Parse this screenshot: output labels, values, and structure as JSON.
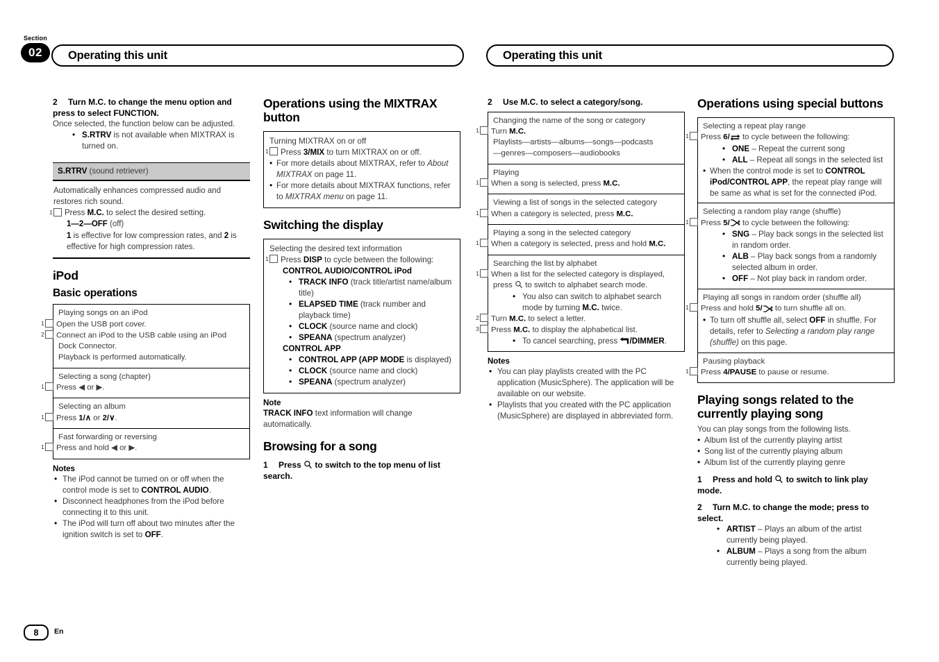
{
  "header": {
    "section_label": "Section",
    "section_number": "02",
    "title_left": "Operating this unit",
    "title_right": "Operating this unit"
  },
  "footer": {
    "page_number": "8",
    "language": "En"
  },
  "col1": {
    "step2_num": "2",
    "step2_text": "Turn M.C. to change the menu option and press to select FUNCTION.",
    "step2_body": "Once selected, the function below can be adjusted.",
    "step2_bullet_1_bold": "S.RTRV",
    "step2_bullet_1_rest": " is not available when MIXTRAX is turned on.",
    "srtrv_band_bold": "S.RTRV",
    "srtrv_band_rest": " (sound retriever)",
    "srtrv_line1": "Automatically enhances compressed audio and restores rich sound.",
    "srtrv_step_marker": "1",
    "srtrv_step_1a": "Press ",
    "srtrv_step_1b": "M.C.",
    "srtrv_step_1c": " to select the desired setting.",
    "srtrv_values": "1—2—OFF (off)",
    "srtrv_values_bold1": "1",
    "srtrv_values_dash1": "—",
    "srtrv_values_bold2": "2",
    "srtrv_values_dash2": "—",
    "srtrv_values_bold3": "OFF",
    "srtrv_values_tail": " (off)",
    "srtrv_note_a": "1",
    "srtrv_note_b": " is effective for low compression rates, and ",
    "srtrv_note_c": "2",
    "srtrv_note_d": " is effective for high compression rates.",
    "ipod_title": "iPod",
    "basic_ops_title": "Basic operations",
    "box_rows": [
      {
        "caption": "Playing songs on an iPod",
        "lines": [
          {
            "marker": "1",
            "text": "Open the USB port cover."
          },
          {
            "marker": "2",
            "text": "Connect an iPod to the USB cable using an iPod Dock Connector."
          },
          {
            "marker": "",
            "text": "Playback is performed automatically."
          }
        ]
      },
      {
        "caption": "Selecting a song (chapter)",
        "lines": [
          {
            "marker": "1",
            "text": "Press ◀ or ▶."
          }
        ]
      },
      {
        "caption": "Selecting an album",
        "lines": [
          {
            "marker": "1",
            "text": "Press 1/∧ or 2/∨."
          }
        ]
      },
      {
        "caption": "Fast forwarding or reversing",
        "lines": [
          {
            "marker": "1",
            "text": "Press and hold ◀ or ▶."
          }
        ]
      }
    ],
    "notes_title": "Notes",
    "notes": [
      "The iPod cannot be turned on or off when the control mode is set to CONTROL AUDIO.",
      "Disconnect headphones from the iPod before connecting it to this unit.",
      "The iPod will turn off about two minutes after the ignition switch is set to OFF."
    ]
  },
  "col2": {
    "mixtrax_title": "Operations using the MIXTRAX button",
    "mixtrax_box_caption": "Turning MIXTRAX on or off",
    "mixtrax_step_marker": "1",
    "mixtrax_step_text": "Press 3/MIX to turn MIXTRAX on or off.",
    "mixtrax_bullets": [
      "For more details about MIXTRAX, refer to About MIXTRAX on page 11.",
      "For more details about MIXTRAX functions, refer to MIXTRAX menu on page 11."
    ],
    "switching_title": "Switching the display",
    "switch_caption": "Selecting the desired text information",
    "switch_step_marker": "1",
    "switch_step_text": "Press DISP to cycle between the following:",
    "group1_title": "CONTROL AUDIO/CONTROL iPod",
    "group1_items": [
      {
        "bold": "TRACK INFO",
        "rest": " (track title/artist name/album title)"
      },
      {
        "bold": "ELAPSED TIME",
        "rest": " (track number and playback time)"
      },
      {
        "bold": "CLOCK",
        "rest": " (source name and clock)"
      },
      {
        "bold": "SPEANA",
        "rest": " (spectrum analyzer)"
      }
    ],
    "group2_title": "CONTROL APP",
    "group2_items": [
      {
        "bold": "CONTROL APP (APP MODE",
        "rest": " is displayed)"
      },
      {
        "bold": "CLOCK",
        "rest": " (source name and clock)"
      },
      {
        "bold": "SPEANA",
        "rest": " (spectrum analyzer)"
      }
    ],
    "note_title": "Note",
    "note_bold": "TRACK INFO",
    "note_rest": " text information will change automatically.",
    "browsing_title": "Browsing for a song",
    "browse_step_num": "1",
    "browse_step_a": "Press ",
    "browse_step_b": " to switch to the top menu of list search."
  },
  "col3": {
    "step2_num": "2",
    "step2_text": "Use M.C. to select a category/song.",
    "box_rows": [
      {
        "caption": "Changing the name of the song or category",
        "marker": "1",
        "line1": "Turn M.C.",
        "line2": "Playlists—artists—albums—songs—podcasts",
        "line3": "—genres—composers—audiobooks"
      },
      {
        "caption": "Playing",
        "marker": "1",
        "line1": "When a song is selected, press M.C."
      },
      {
        "caption": "Viewing a list of songs in the selected category",
        "marker": "1",
        "line1": "When a category is selected, press M.C."
      },
      {
        "caption": "Playing a song in the selected category",
        "marker": "1",
        "line1": "When a category is selected, press and hold M.C."
      }
    ],
    "alpha_caption": "Searching the list by alphabet",
    "alpha_step1_marker": "1",
    "alpha_step1_a": "When a list for the selected category is displayed, press ",
    "alpha_step1_b": " to switch to alphabet search mode.",
    "alpha_sub_bullet_a": "You also can switch to alphabet search mode by turning ",
    "alpha_sub_bullet_b": "M.C.",
    "alpha_sub_bullet_c": " twice.",
    "alpha_step2_marker": "2",
    "alpha_step2_a": "Turn ",
    "alpha_step2_b": "M.C.",
    "alpha_step2_c": " to select a letter.",
    "alpha_step3_marker": "3",
    "alpha_step3_a": "Press ",
    "alpha_step3_b": "M.C.",
    "alpha_step3_c": " to display the alphabetical list.",
    "alpha_cancel_a": "To cancel searching, press ",
    "alpha_cancel_b": "/DIMMER",
    "alpha_cancel_c": ".",
    "notes_title": "Notes",
    "notes": [
      "You can play playlists created with the PC application (MusicSphere). The application will be available on our website.",
      "Playlists that you created with the PC application (MusicSphere) are displayed in abbreviated form."
    ]
  },
  "col4": {
    "special_title": "Operations using special buttons",
    "repeat_caption": "Selecting a repeat play range",
    "repeat_marker": "1",
    "repeat_press_a": "Press ",
    "repeat_press_b": "6/",
    "repeat_press_c": " to cycle between the following:",
    "repeat_items": [
      {
        "bold": "ONE",
        "rest": " – Repeat the current song"
      },
      {
        "bold": "ALL",
        "rest": " – Repeat all songs in the selected list"
      }
    ],
    "repeat_note_a": "When the control mode is set to ",
    "repeat_note_b": "CONTROL iPod/CONTROL APP",
    "repeat_note_c": ", the repeat play range will be same as what is set for the connected iPod.",
    "shuffle_caption": "Selecting a random play range (shuffle)",
    "shuffle_marker": "1",
    "shuffle_press_a": "Press ",
    "shuffle_press_b": "5/",
    "shuffle_press_c": " to cycle between the following:",
    "shuffle_items": [
      {
        "bold": "SNG",
        "rest": " – Play back songs in the selected list in random order."
      },
      {
        "bold": "ALB",
        "rest": " – Play back songs from a randomly selected album in order."
      },
      {
        "bold": "OFF",
        "rest": " – Not play back in random order."
      }
    ],
    "shuffleall_caption": "Playing all songs in random order (shuffle all)",
    "shuffleall_marker": "1",
    "shuffleall_a": "Press and hold ",
    "shuffleall_b": "5/",
    "shuffleall_c": " to turn shuffle all on.",
    "shuffleall_note_a": "To turn off shuffle all, select ",
    "shuffleall_note_b": "OFF",
    "shuffleall_note_c": " in shuffle. For details, refer to ",
    "shuffleall_note_i": "Selecting a random play range (shuffle)",
    "shuffleall_note_d": " on this page.",
    "pause_caption": "Pausing playback",
    "pause_marker": "1",
    "pause_a": "Press ",
    "pause_b": "4/PAUSE",
    "pause_c": " to pause or resume.",
    "related_title": "Playing songs related to the currently playing song",
    "related_intro": "You can play songs from the following lists.",
    "related_list": [
      "Album list of the currently playing artist",
      "Song list of the currently playing album",
      "Album list of the currently playing genre"
    ],
    "related_step1_num": "1",
    "related_step1_a": "Press and hold ",
    "related_step1_b": " to switch to link play mode.",
    "related_step2_num": "2",
    "related_step2": "Turn M.C. to change the mode; press to select.",
    "related_modes": [
      {
        "bold": "ARTIST",
        "rest": " – Plays an album of the artist currently being played."
      },
      {
        "bold": "ALBUM",
        "rest": " – Plays a song from the album currently being played."
      }
    ]
  },
  "icons": {
    "search": "magnifier-icon",
    "repeat": "repeat-icon",
    "shuffle": "shuffle-icon",
    "back": "back-dimmer-icon"
  }
}
